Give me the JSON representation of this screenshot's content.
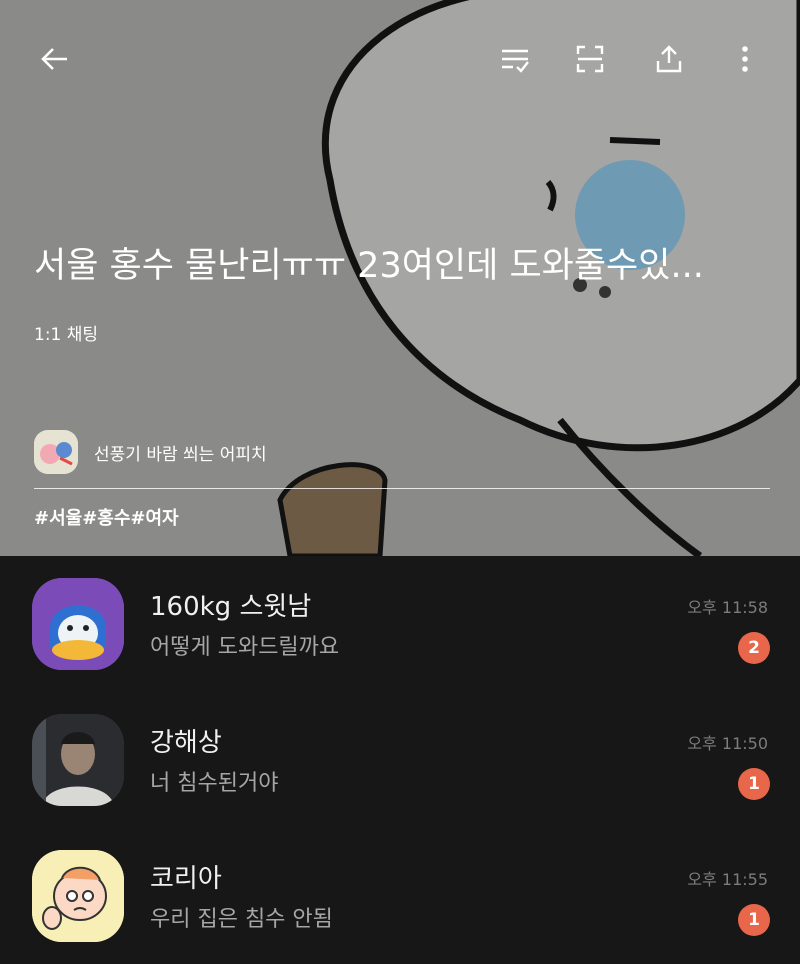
{
  "header": {
    "title": "서울 홍수 물난리ㅠㅠ 23여인데 도와줄수있...",
    "subtitle": "1:1 채팅",
    "owner_name": "선풍기 바람 쐬는 어피치",
    "hashtags": "#서울#홍수#여자",
    "icons": [
      "back-arrow-icon",
      "checklist-icon",
      "scan-icon",
      "share-icon",
      "more-icon"
    ]
  },
  "chats": [
    {
      "name": "160kg 스윗남",
      "message": "어떻게 도와드릴까요",
      "time": "오후 11:58",
      "unread": "2",
      "avatar_color": "#7b4bb7"
    },
    {
      "name": "강해상",
      "message": "너 침수된거야",
      "time": "오후 11:50",
      "unread": "1",
      "avatar_color": "#3a3a3a"
    },
    {
      "name": "코리아",
      "message": "우리 집은 침수 안됨",
      "time": "오후 11:55",
      "unread": "1",
      "avatar_color": "#f7efb5"
    }
  ],
  "colors": {
    "badge": "#e8664a",
    "header_bg": "#8a8a89",
    "list_bg": "#171717"
  }
}
